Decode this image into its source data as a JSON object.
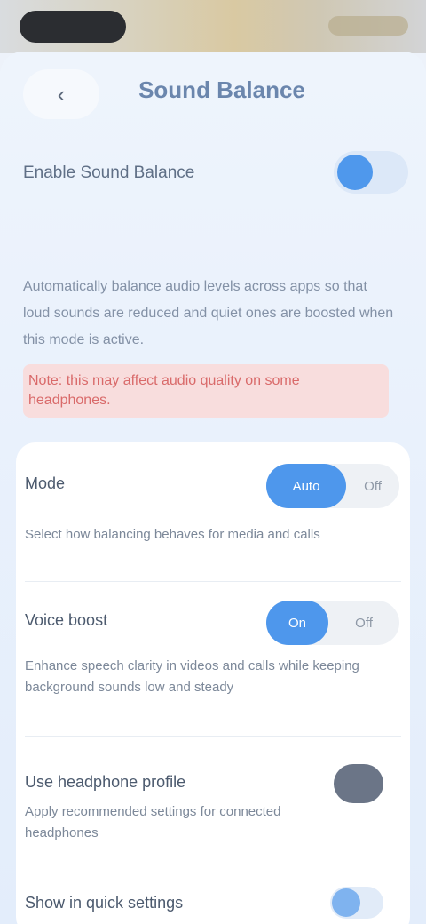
{
  "header": {
    "title": "Sound Balance",
    "back_icon": "chevron-left-icon"
  },
  "master": {
    "label": "Enable Sound Balance",
    "enabled": true
  },
  "description": "Automatically balance audio levels across apps so that loud sounds are reduced and quiet ones are boosted when this mode is active.",
  "warning": "Note: this may affect audio quality on some headphones.",
  "sections": [
    {
      "title": "Mode",
      "on_label": "Auto",
      "off_label": "Off",
      "description": "Select how balancing behaves for media and calls"
    },
    {
      "title": "Voice boost",
      "on_label": "On",
      "off_label": "Off",
      "description": "Enhance speech clarity in videos and calls while keeping background sounds low and steady"
    },
    {
      "title": "Use headphone profile",
      "description": "Apply recommended settings for connected headphones"
    },
    {
      "title": "Show in quick settings"
    }
  ],
  "colors": {
    "accent": "#4e97ec",
    "warning_text": "#d96a6a",
    "warning_bg": "#f8dddd"
  }
}
